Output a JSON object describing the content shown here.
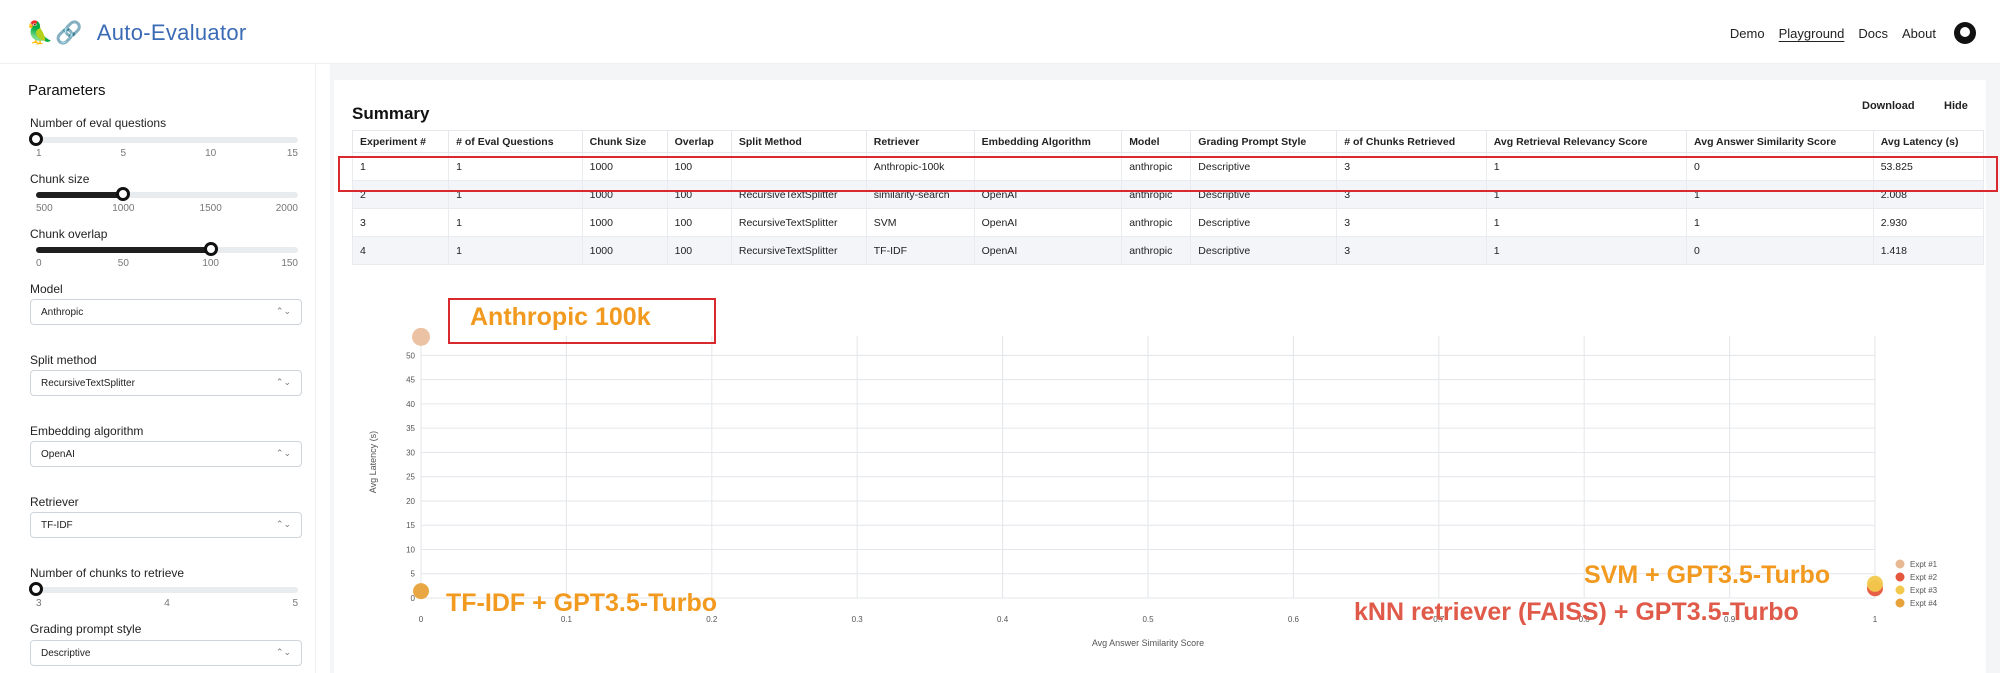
{
  "app": {
    "logo_icons": "🦜🔗",
    "title": "Auto-Evaluator",
    "nav": [
      "Demo",
      "Playground",
      "Docs",
      "About"
    ],
    "active_nav": "Playground"
  },
  "sidebar": {
    "title": "Parameters",
    "eval_questions": {
      "label": "Number of eval questions",
      "ticks": [
        "1",
        "5",
        "10",
        "15"
      ],
      "min": 1,
      "max": 15,
      "value": 1
    },
    "chunk_size": {
      "label": "Chunk size",
      "ticks": [
        "500",
        "1000",
        "1500",
        "2000"
      ],
      "min": 500,
      "max": 2000,
      "value": 1000
    },
    "chunk_overlap": {
      "label": "Chunk overlap",
      "ticks": [
        "0",
        "50",
        "100",
        "150"
      ],
      "min": 0,
      "max": 150,
      "value": 100
    },
    "model": {
      "label": "Model",
      "value": "Anthropic"
    },
    "split_method": {
      "label": "Split method",
      "value": "RecursiveTextSplitter"
    },
    "embedding": {
      "label": "Embedding algorithm",
      "value": "OpenAI"
    },
    "retriever": {
      "label": "Retriever",
      "value": "TF-IDF"
    },
    "num_chunks": {
      "label": "Number of chunks to retrieve",
      "ticks": [
        "3",
        "4",
        "5"
      ],
      "min": 3,
      "max": 5,
      "value": 3
    },
    "grading_style": {
      "label": "Grading prompt style",
      "value": "Descriptive"
    }
  },
  "summary": {
    "title": "Summary",
    "download_label": "Download",
    "hide_label": "Hide",
    "columns": [
      "Experiment #",
      "# of Eval Questions",
      "Chunk Size",
      "Overlap",
      "Split Method",
      "Retriever",
      "Embedding Algorithm",
      "Model",
      "Grading Prompt Style",
      "# of Chunks Retrieved",
      "Avg Retrieval Relevancy Score",
      "Avg Answer Similarity Score",
      "Avg Latency (s)"
    ],
    "rows": [
      [
        "1",
        "1",
        "1000",
        "100",
        "",
        "Anthropic-100k",
        "",
        "anthropic",
        "Descriptive",
        "3",
        "1",
        "0",
        "53.825"
      ],
      [
        "2",
        "1",
        "1000",
        "100",
        "RecursiveTextSplitter",
        "similarity-search",
        "OpenAI",
        "anthropic",
        "Descriptive",
        "3",
        "1",
        "1",
        "2.008"
      ],
      [
        "3",
        "1",
        "1000",
        "100",
        "RecursiveTextSplitter",
        "SVM",
        "OpenAI",
        "anthropic",
        "Descriptive",
        "3",
        "1",
        "1",
        "2.930"
      ],
      [
        "4",
        "1",
        "1000",
        "100",
        "RecursiveTextSplitter",
        "TF-IDF",
        "OpenAI",
        "anthropic",
        "Descriptive",
        "3",
        "1",
        "0",
        "1.418"
      ]
    ]
  },
  "chart_data": {
    "type": "scatter",
    "xlabel": "Avg Answer Similarity Score",
    "ylabel": "Avg Latency (s)",
    "xlim": [
      0,
      1
    ],
    "ylim": [
      0,
      54
    ],
    "x_ticks": [
      "0",
      "0.1",
      "0.2",
      "0.3",
      "0.4",
      "0.5",
      "0.6",
      "0.7",
      "0.8",
      "0.9",
      "1"
    ],
    "y_ticks": [
      "0",
      "5",
      "10",
      "15",
      "20",
      "25",
      "30",
      "35",
      "40",
      "45",
      "50"
    ],
    "grid": true,
    "legend_position": "right",
    "series": [
      {
        "name": "Expt #1",
        "color": "#e8b894",
        "points": [
          [
            0,
            53.825
          ]
        ]
      },
      {
        "name": "Expt #2",
        "color": "#e4573c",
        "points": [
          [
            1,
            2.008
          ]
        ]
      },
      {
        "name": "Expt #3",
        "color": "#f2c94c",
        "points": [
          [
            1,
            2.93
          ]
        ]
      },
      {
        "name": "Expt #4",
        "color": "#e8a23a",
        "points": [
          [
            0,
            1.418
          ]
        ]
      }
    ],
    "annotations": [
      {
        "text": "Anthropic 100k",
        "color": "#f29a1f"
      },
      {
        "text": "TF-IDF + GPT3.5-Turbo",
        "color": "#f29a1f"
      },
      {
        "text": "SVM + GPT3.5-Turbo",
        "color": "#f29a1f"
      },
      {
        "text": "kNN retriever (FAISS) + GPT3.5-Turbo",
        "color": "#e05a4a"
      }
    ]
  }
}
